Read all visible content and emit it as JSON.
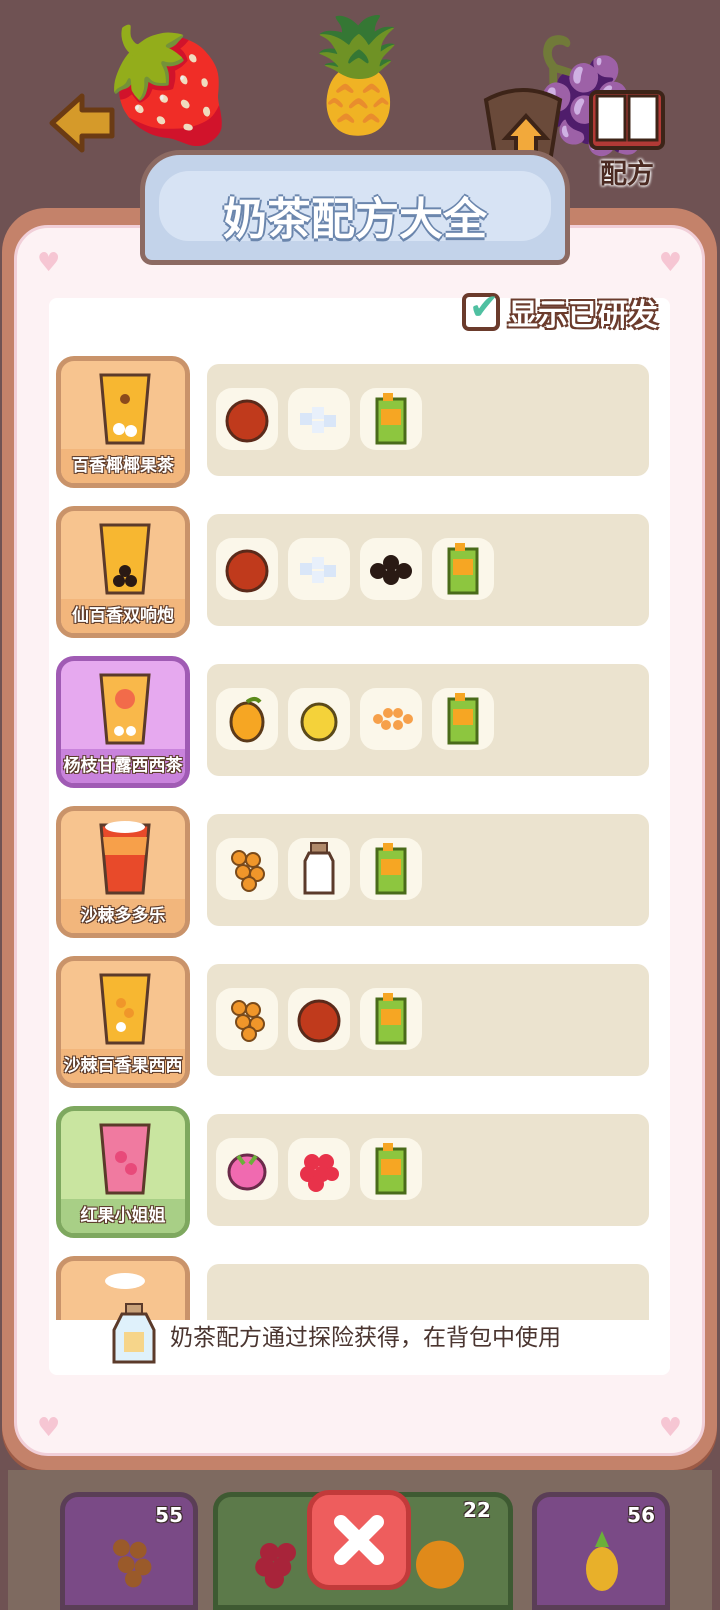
{
  "header": {
    "back_icon": "back-arrow-icon",
    "upgrade_label": "升级",
    "recipe_label": "配方"
  },
  "panel": {
    "title": "奶茶配方大全",
    "show_developed_label": "显示已研发",
    "show_developed_checked": true,
    "hint": "奶茶配方通过探险获得，在背包中使用"
  },
  "recipes": [
    {
      "name": "百香椰椰果茶",
      "card_color": "orange",
      "ingredients": [
        "passion-fruit-icon",
        "coconut-jelly-icon",
        "tea-box-icon"
      ]
    },
    {
      "name": "仙百香双响炮",
      "card_color": "orange",
      "ingredients": [
        "passion-fruit-icon",
        "coconut-jelly-icon",
        "pearl-boba-icon",
        "tea-box-icon"
      ]
    },
    {
      "name": "杨枝甘露西西茶",
      "card_color": "purple",
      "ingredients": [
        "mango-icon",
        "lemon-icon",
        "popping-boba-icon",
        "tea-box-icon"
      ]
    },
    {
      "name": "沙棘多多乐",
      "card_color": "orange",
      "ingredients": [
        "sea-buckthorn-icon",
        "milk-bottle-icon",
        "tea-box-icon"
      ]
    },
    {
      "name": "沙棘百香果西西",
      "card_color": "orange",
      "ingredients": [
        "sea-buckthorn-icon",
        "passion-fruit-icon",
        "tea-box-icon"
      ]
    },
    {
      "name": "红果小姐姐",
      "card_color": "green",
      "ingredients": [
        "dragon-fruit-icon",
        "raspberry-icon",
        "tea-box-icon"
      ]
    }
  ],
  "tray": [
    {
      "item": "sea-buckthorn-icon",
      "count": "55"
    },
    {
      "item": "raspberry-icon",
      "count": ""
    },
    {
      "item": "orange-icon",
      "count": "22"
    },
    {
      "item": "pineapple-icon",
      "count": "56"
    }
  ]
}
